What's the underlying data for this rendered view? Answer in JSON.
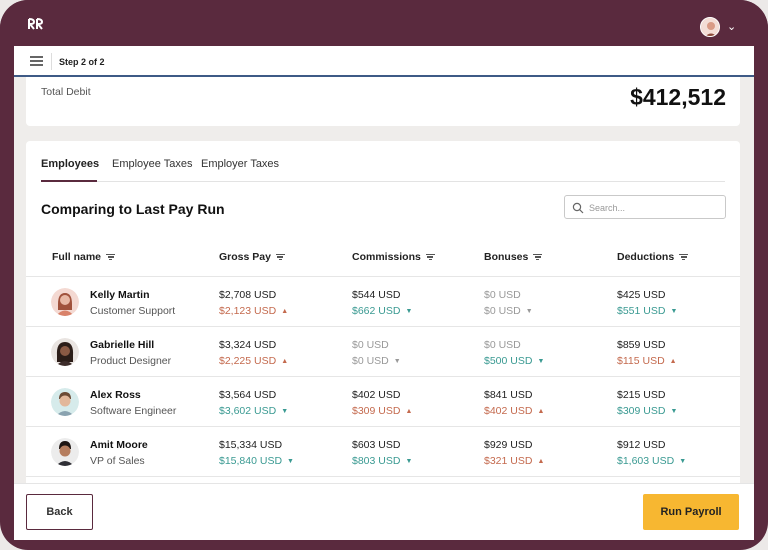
{
  "app": {
    "logo_text": "RR"
  },
  "stepbar": {
    "label": "Step 2 of 2"
  },
  "debit": {
    "label": "Total Debit",
    "value": "$412,512"
  },
  "tabs": [
    {
      "label": "Employees",
      "active": true
    },
    {
      "label": "Employee Taxes",
      "active": false
    },
    {
      "label": "Employer Taxes",
      "active": false
    }
  ],
  "section": {
    "title": "Comparing to Last Pay Run"
  },
  "search": {
    "placeholder": "Search..."
  },
  "table": {
    "headers": [
      "Full name",
      "Gross Pay",
      "Commissions",
      "Bonuses",
      "Deductions"
    ],
    "rows": [
      {
        "name": "Kelly Martin",
        "role": "Customer Support",
        "gross": {
          "current": "$2,708 USD",
          "previous": "$2,123 USD",
          "trend": "up"
        },
        "commissions": {
          "current": "$544 USD",
          "previous": "$662 USD",
          "trend": "down"
        },
        "bonuses": {
          "current": "$0 USD",
          "previous": "$0 USD",
          "trend": "none"
        },
        "deductions": {
          "current": "$425 USD",
          "previous": "$551 USD",
          "trend": "down"
        }
      },
      {
        "name": "Gabrielle Hill",
        "role": "Product Designer",
        "gross": {
          "current": "$3,324 USD",
          "previous": "$2,225 USD",
          "trend": "up"
        },
        "commissions": {
          "current": "$0 USD",
          "previous": "$0 USD",
          "trend": "none"
        },
        "bonuses": {
          "current": "$0 USD",
          "previous": "$500 USD",
          "trend": "down"
        },
        "deductions": {
          "current": "$859 USD",
          "previous": "$115 USD",
          "trend": "up"
        }
      },
      {
        "name": "Alex Ross",
        "role": "Software Engineer",
        "gross": {
          "current": "$3,564 USD",
          "previous": "$3,602 USD",
          "trend": "down"
        },
        "commissions": {
          "current": "$402 USD",
          "previous": "$309 USD",
          "trend": "up"
        },
        "bonuses": {
          "current": "$841 USD",
          "previous": "$402 USD",
          "trend": "up"
        },
        "deductions": {
          "current": "$215 USD",
          "previous": "$309 USD",
          "trend": "down"
        }
      },
      {
        "name": "Amit Moore",
        "role": "VP of Sales",
        "gross": {
          "current": "$15,334 USD",
          "previous": "$15,840 USD",
          "trend": "down"
        },
        "commissions": {
          "current": "$603 USD",
          "previous": "$803 USD",
          "trend": "down"
        },
        "bonuses": {
          "current": "$929 USD",
          "previous": "$321 USD",
          "trend": "up"
        },
        "deductions": {
          "current": "$912 USD",
          "previous": "$1,603 USD",
          "trend": "down"
        }
      }
    ]
  },
  "footer": {
    "back_label": "Back",
    "run_label": "Run Payroll"
  },
  "colors": {
    "brand": "#5a2a3e",
    "accent": "#f7b731",
    "up": "#c46a4e",
    "down": "#3a9a92",
    "progress": "#3e5a86"
  }
}
